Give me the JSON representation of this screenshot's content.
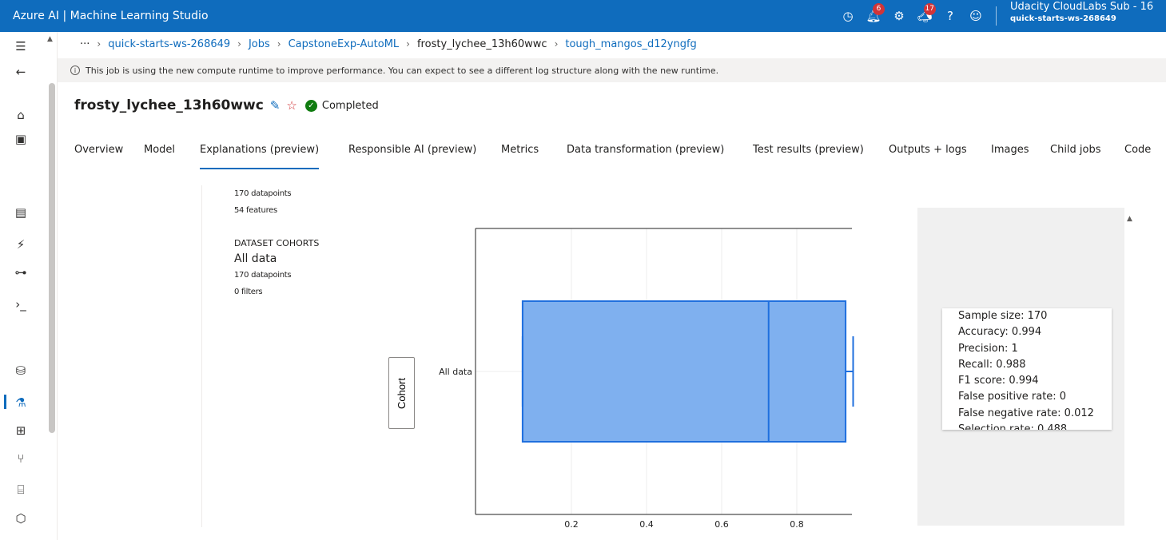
{
  "header": {
    "brand": "Azure AI | Machine Learning Studio",
    "notifications_count": "6",
    "feedback_count": "17",
    "help_label": "?",
    "account_name": "Udacity CloudLabs Sub - 16",
    "workspace_name": "quick-starts-ws-268649"
  },
  "breadcrumb": {
    "more": "···",
    "items": [
      "quick-starts-ws-268649",
      "Jobs",
      "CapstoneExp-AutoML",
      "frosty_lychee_13h60wwc",
      "tough_mangos_d12yngfg"
    ]
  },
  "info_banner": "This job is using the new compute runtime to improve performance. You can expect to see a different log structure along with the new runtime.",
  "job": {
    "title": "frosty_lychee_13h60wwc",
    "status": "Completed"
  },
  "tabs": [
    "Overview",
    "Model",
    "Explanations (preview)",
    "Responsible AI (preview)",
    "Metrics",
    "Data transformation (preview)",
    "Test results (preview)",
    "Outputs + logs",
    "Images",
    "Child jobs",
    "Code"
  ],
  "active_tab": "Explanations (preview)",
  "dataset": {
    "datapoints": "170 datapoints",
    "features": "54 features",
    "cohorts_heading": "DATASET COHORTS",
    "cohort_name": "All data",
    "cohort_datapoints": "170 datapoints",
    "cohort_filters": "0 filters"
  },
  "cohort_axis_button": "Cohort",
  "chart_data": {
    "type": "box",
    "orientation": "horizontal",
    "categories": [
      "All data"
    ],
    "box": {
      "min": 0.07,
      "q1": 0.07,
      "median": 0.725,
      "q3": 0.93,
      "max": 0.95
    },
    "xlim": [
      0,
      1
    ],
    "xticks": [
      "0.2",
      "0.4",
      "0.6",
      "0.8",
      "1"
    ],
    "color": "#7fb0ef",
    "edge_color": "#1f6fde"
  },
  "metrics": [
    "Sample size: 170",
    "Accuracy: 0.994",
    "Precision: 1",
    "Recall: 0.988",
    "F1 score: 0.994",
    "False positive rate: 0",
    "False negative rate: 0.012",
    "Selection rate: 0.488"
  ]
}
